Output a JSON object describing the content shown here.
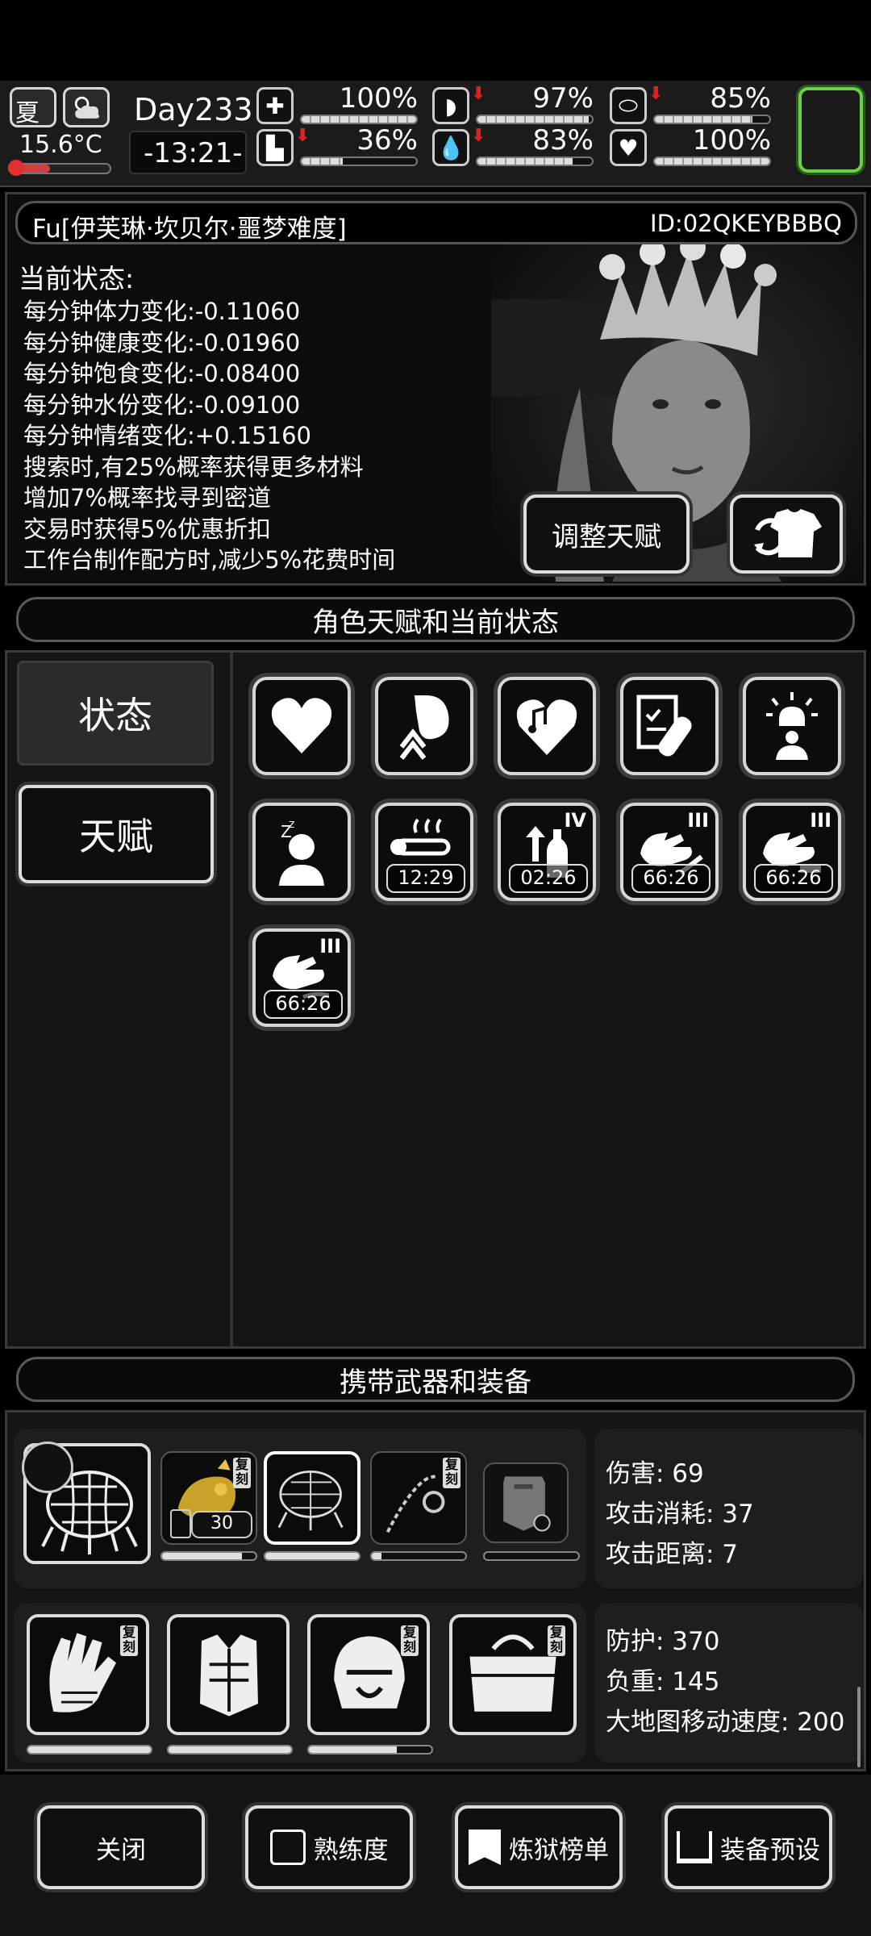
{
  "header": {
    "season": "夏",
    "temperature": "15.6°C",
    "day": "Day233",
    "time": "-13:21-",
    "stats": [
      {
        "icon": "medkit-icon",
        "value": "100%",
        "level": 1.0,
        "down": false
      },
      {
        "icon": "stomach-icon",
        "value": "97%",
        "level": 0.97,
        "down": true
      },
      {
        "icon": "pill-icon",
        "value": "85%",
        "level": 0.85,
        "down": true
      },
      {
        "icon": "boot-icon",
        "value": "36%",
        "level": 0.36,
        "down": true
      },
      {
        "icon": "water-drop-icon",
        "value": "83%",
        "level": 0.83,
        "down": true
      },
      {
        "icon": "heart-icon",
        "value": "100%",
        "level": 1.0,
        "down": false
      }
    ]
  },
  "character": {
    "name": "Fu[伊芙琳·坎贝尔·噩梦难度]",
    "id": "ID:02QKEYBBBQ",
    "status_title": "当前状态:",
    "effects": [
      "每分钟体力变化:-0.11060",
      "每分钟健康变化:-0.01960",
      "每分钟饱食变化:-0.08400",
      "每分钟水份变化:-0.09100",
      "每分钟情绪变化:+0.15160",
      "搜索时,有25%概率获得更多材料",
      "增加7%概率找寻到密道",
      "交易时获得5%优惠折扣",
      "工作台制作配方时,减少5%花费时间"
    ],
    "adjust_talent": "调整天赋"
  },
  "talents": {
    "section_title": "角色天赋和当前状态",
    "tab_status": "状态",
    "tab_talent": "天赋",
    "icons": [
      {
        "name": "heart-status-icon",
        "timer": "",
        "roman": ""
      },
      {
        "name": "stomach-up-icon",
        "timer": "",
        "roman": ""
      },
      {
        "name": "music-heart-icon",
        "timer": "",
        "roman": ""
      },
      {
        "name": "clipboard-bandage-icon",
        "timer": "",
        "roman": ""
      },
      {
        "name": "alarm-person-icon",
        "timer": "",
        "roman": ""
      },
      {
        "name": "sleeping-person-icon",
        "timer": "",
        "roman": ""
      },
      {
        "name": "hot-thermometer-icon",
        "timer": "12:29",
        "roman": ""
      },
      {
        "name": "bottle-up-icon",
        "timer": "02:26",
        "roman": "IV"
      },
      {
        "name": "hand-pencil-icon",
        "timer": "66:26",
        "roman": "III"
      },
      {
        "name": "hand-tool-icon",
        "timer": "66:26",
        "roman": "III"
      },
      {
        "name": "hand-brush-icon",
        "timer": "66:26",
        "roman": "III"
      }
    ]
  },
  "equipment": {
    "section_title": "携带武器和装备",
    "weapon_stats": {
      "damage": "伤害: 69",
      "cost": "攻击消耗: 37",
      "range": "攻击距离: 7"
    },
    "armor_stats": {
      "defense": "防护: 370",
      "weight": "负重: 145",
      "speed": "大地图移动速度: 200"
    },
    "ammo_count": "30",
    "copy_tag": "复刻",
    "weapon_durability": [
      0.85,
      1.0,
      0.1,
      0.0
    ],
    "armor_durability": [
      1.0,
      1.0,
      0.72
    ]
  },
  "footer": {
    "close": "关闭",
    "proficiency": "熟练度",
    "ranking": "炼狱榜单",
    "preset": "装备预设"
  }
}
